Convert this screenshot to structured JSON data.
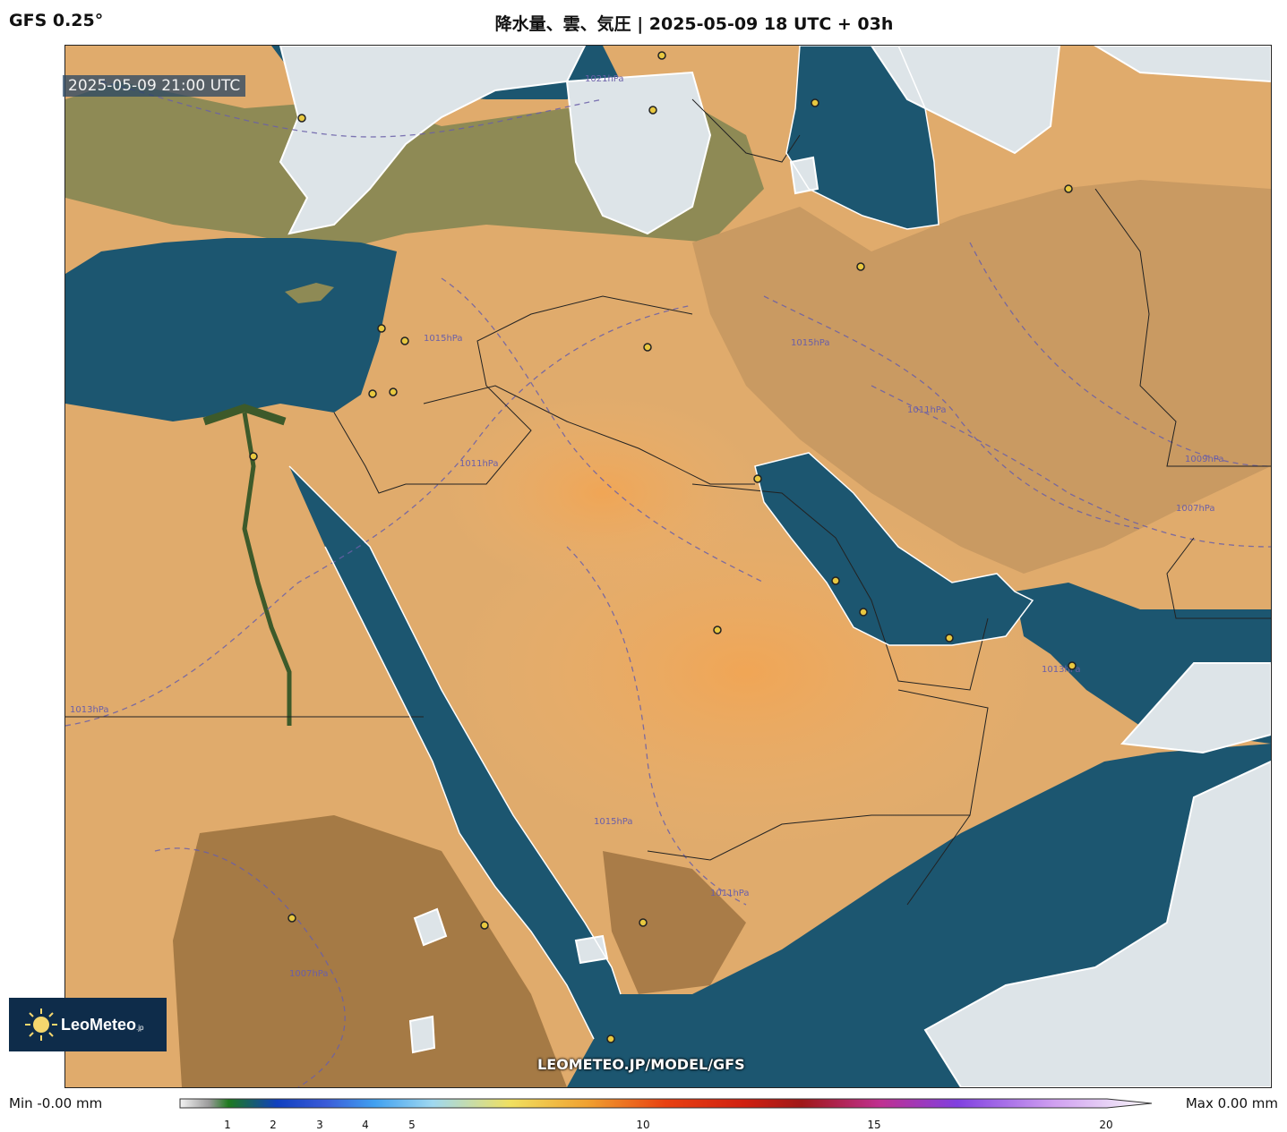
{
  "header": {
    "model": "GFS 0.25°",
    "title": "降水量、雲、気圧 | 2025-05-09 18 UTC + 03h"
  },
  "map": {
    "valid_time": "2025-05-09 21:00 UTC",
    "watermark": "LEOMETEO.JP/MODEL/GFS",
    "isobar_labels": [
      "1021hPa",
      "1015hPa",
      "1015hPa",
      "1011hPa",
      "1013hPa",
      "1011hPa",
      "1007hPa",
      "1009hPa",
      "1015hPa",
      "1011hPa",
      "1007hPa",
      "1013hPa"
    ],
    "colors": {
      "sea": "#1c5670",
      "desert": "#e3ad6e",
      "cloud": "#dfe6ea",
      "isobar": "#6a5fa8",
      "city_marker": "#e8c840"
    }
  },
  "logo": {
    "brand": "LeoMeteo",
    "suffix": ".jp"
  },
  "legend": {
    "min_text": "Min -0.00 mm",
    "max_text": "Max 0.00 mm",
    "ticks": [
      "1",
      "2",
      "3",
      "4",
      "5",
      "10",
      "15",
      "20"
    ]
  }
}
